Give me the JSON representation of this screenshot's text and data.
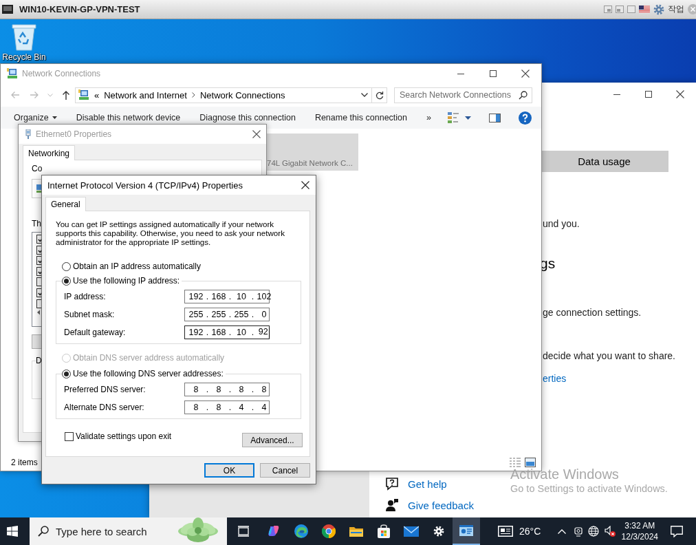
{
  "vm_window": {
    "title": "WIN10-KEVIN-GP-VPN-TEST",
    "action_menu": "작업"
  },
  "desktop_icons": [
    {
      "label": "Recycle Bin"
    }
  ],
  "settings_window": {
    "data_usage_button": "Data usage",
    "lines": [
      {
        "kind": "text",
        "text": "und you."
      },
      {
        "kind": "heading",
        "text": "gs"
      },
      {
        "kind": "text",
        "text": "ge connection settings."
      },
      {
        "kind": "text",
        "text": "decide what you want to share."
      },
      {
        "kind": "link",
        "text": "erties"
      }
    ],
    "help_links": [
      {
        "kind": "help",
        "label": "Get help"
      },
      {
        "kind": "feedback",
        "label": "Give feedback"
      }
    ]
  },
  "network_window": {
    "title": "Network Connections",
    "address_prefix": "«",
    "breadcrumb": [
      "Network and Internet",
      "Network Connections"
    ],
    "search": {
      "placeholder": "Search Network Connections"
    },
    "toolbar": [
      {
        "label": "Organize",
        "kind": "menu"
      },
      {
        "label": "Disable this network device",
        "kind": "action"
      },
      {
        "label": "Diagnose this connection",
        "kind": "action"
      },
      {
        "label": "Rename this connection",
        "kind": "action"
      }
    ],
    "toolbar_overflow": "»",
    "items": [
      {
        "label": "74L Gigabit Network C...",
        "selected": true
      }
    ],
    "status_bar": "2 items"
  },
  "ethernet_dialog": {
    "title": "Ethernet0 Properties",
    "tabs": [
      {
        "label": "Networking",
        "selected": true
      }
    ],
    "connect_label": "Co",
    "items_label": "Th",
    "components": [
      {
        "checked": true
      },
      {
        "checked": true
      },
      {
        "checked": true
      },
      {
        "checked": true
      },
      {
        "checked": false
      },
      {
        "checked": true
      },
      {
        "checked": false
      }
    ],
    "group_label": "D"
  },
  "ipv4_dialog": {
    "title": "Internet Protocol Version 4 (TCP/IPv4) Properties",
    "tabs": [
      {
        "label": "General",
        "selected": true
      }
    ],
    "description": "You can get IP settings assigned automatically if your network supports this capability. Otherwise, you need to ask your network administrator for the appropriate IP settings.",
    "separator": ".",
    "ip_mode": [
      {
        "label": "Obtain an IP address automatically",
        "selected": false,
        "disabled": false
      },
      {
        "label": "Use the following IP address:",
        "selected": true,
        "disabled": false
      }
    ],
    "ip_fields": [
      {
        "label": "IP address:",
        "octets": [
          "192",
          "168",
          "10",
          "102"
        ],
        "focused": false
      },
      {
        "label": "Subnet mask:",
        "octets": [
          "255",
          "255",
          "255",
          "0"
        ],
        "focused": false
      },
      {
        "label": "Default gateway:",
        "octets": [
          "192",
          "168",
          "10",
          "92"
        ],
        "focused": true
      }
    ],
    "dns_mode": [
      {
        "label": "Obtain DNS server address automatically",
        "selected": false,
        "disabled": true
      },
      {
        "label": "Use the following DNS server addresses:",
        "selected": true,
        "disabled": false
      }
    ],
    "dns_fields": [
      {
        "label": "Preferred DNS server:",
        "octets": [
          "8",
          "8",
          "8",
          "8"
        ],
        "focused": false
      },
      {
        "label": "Alternate DNS server:",
        "octets": [
          "8",
          "8",
          "4",
          "4"
        ],
        "focused": false
      }
    ],
    "validate": {
      "label": "Validate settings upon exit",
      "checked": false
    },
    "advanced_button": "Advanced...",
    "buttons": [
      {
        "label": "OK",
        "default": true
      },
      {
        "label": "Cancel",
        "default": false
      }
    ]
  },
  "activation_notice": {
    "title": "Activate Windows",
    "message": "Go to Settings to activate Windows."
  },
  "taskbar": {
    "search": {
      "placeholder": "Type here to search"
    },
    "apps": [
      {
        "kind": "task-view",
        "active": false
      },
      {
        "kind": "copilot",
        "active": false
      },
      {
        "kind": "edge",
        "active": false
      },
      {
        "kind": "chrome",
        "active": false
      },
      {
        "kind": "explorer",
        "active": false
      },
      {
        "kind": "store",
        "active": false
      },
      {
        "kind": "mail",
        "active": false
      },
      {
        "kind": "settings",
        "active": false
      },
      {
        "kind": "network-app",
        "active": true
      }
    ],
    "weather": "26°C",
    "time": "3:32 AM",
    "date": "12/3/2024"
  }
}
